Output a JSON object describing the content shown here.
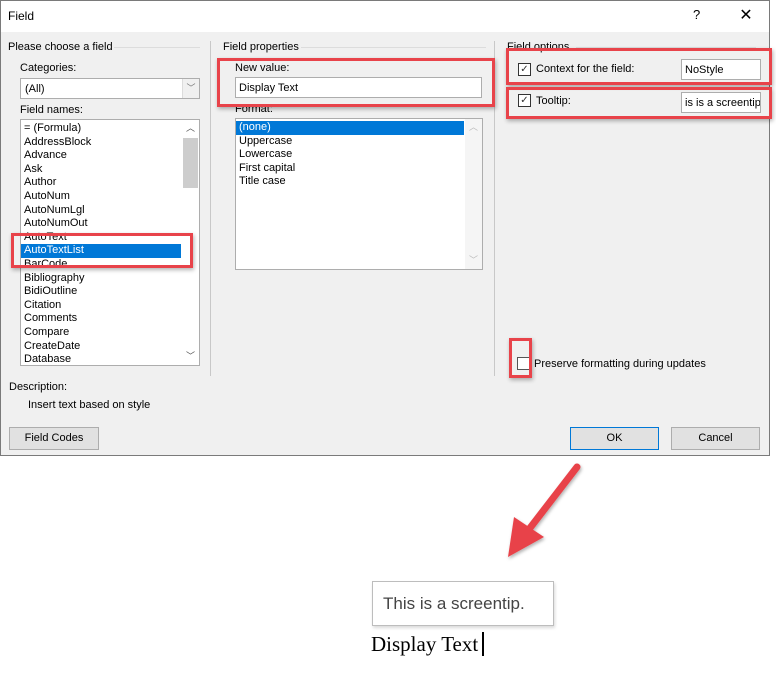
{
  "window": {
    "title": "Field",
    "help_label": "?",
    "close_label": "✕"
  },
  "left_panel": {
    "group_title": "Please choose a field",
    "categories_label": "Categories:",
    "categories_value": "(All)",
    "field_names_label": "Field names:",
    "field_names": [
      "= (Formula)",
      "AddressBlock",
      "Advance",
      "Ask",
      "Author",
      "AutoNum",
      "AutoNumLgl",
      "AutoNumOut",
      "AutoText",
      "AutoTextList",
      "BarCode",
      "Bibliography",
      "BidiOutline",
      "Citation",
      "Comments",
      "Compare",
      "CreateDate",
      "Database"
    ],
    "selected_field": "AutoTextList"
  },
  "middle_panel": {
    "group_title": "Field properties",
    "new_value_label": "New value:",
    "new_value": "Display Text",
    "format_label": "Format:",
    "formats": [
      "(none)",
      "Uppercase",
      "Lowercase",
      "First capital",
      "Title case"
    ],
    "selected_format": "(none)"
  },
  "right_panel": {
    "group_title": "Field options",
    "context_label": "Context for the field:",
    "context_checked": true,
    "context_value": "NoStyle",
    "tooltip_label": "Tooltip:",
    "tooltip_checked": true,
    "tooltip_value": "is is a screentip.",
    "preserve_label": "Preserve formatting during updates",
    "preserve_checked": false
  },
  "description": {
    "label": "Description:",
    "text": "Insert text based on style"
  },
  "buttons": {
    "field_codes": "Field Codes",
    "ok": "OK",
    "cancel": "Cancel"
  },
  "result": {
    "screentip_text": "This is a screentip.",
    "document_text": "Display Text"
  },
  "colors": {
    "highlight": "#e8434a",
    "selection": "#0078d7"
  }
}
